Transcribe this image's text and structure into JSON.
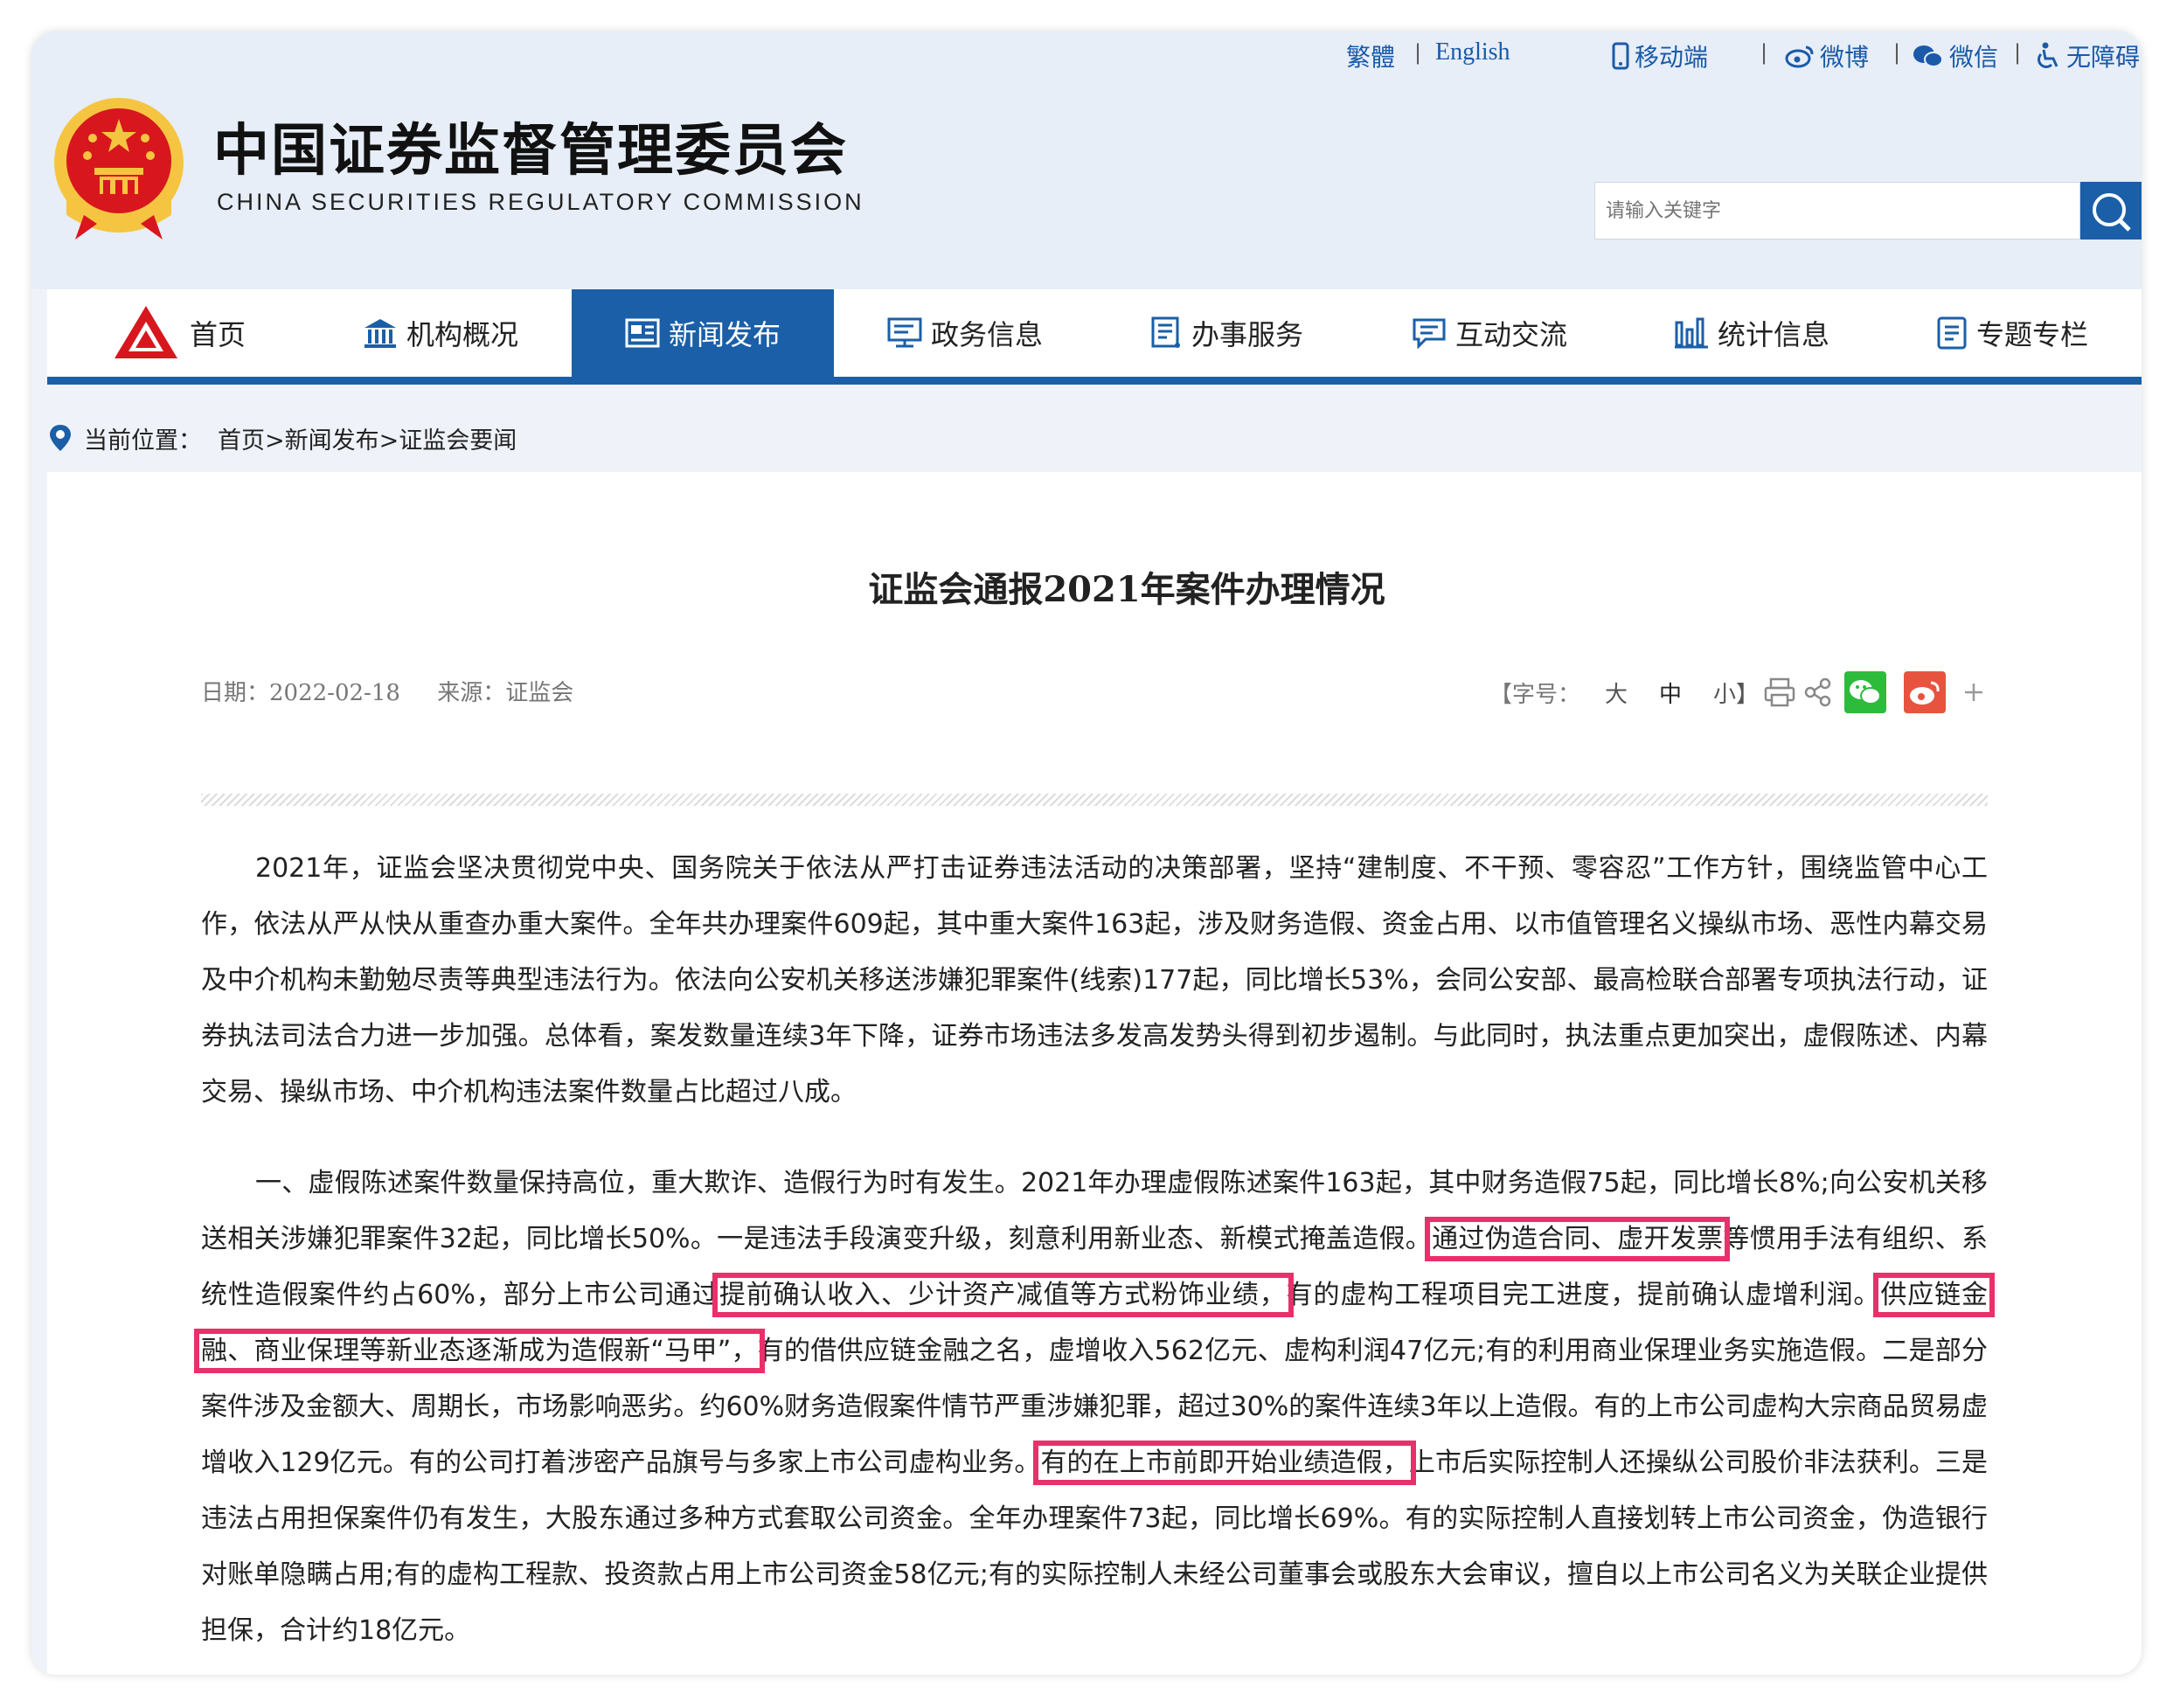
{
  "header": {
    "title_cn": "中国证券监督管理委员会",
    "title_en": "CHINA SECURITIES REGULATORY COMMISSION",
    "top_links": [
      "繁體",
      "English",
      "移动端",
      "微博",
      "微信",
      "无障碍"
    ],
    "search_placeholder": "请输入关键字"
  },
  "nav": {
    "items": [
      "首页",
      "机构概况",
      "新闻发布",
      "政务信息",
      "办事服务",
      "互动交流",
      "统计信息",
      "专题专栏"
    ],
    "active": "新闻发布"
  },
  "breadcrumb": {
    "label": "当前位置：",
    "path": "首页>新闻发布>证监会要闻"
  },
  "article": {
    "title": "证监会通报2021年案件办理情况",
    "date": "日期：2022-02-18",
    "source": "来源：证监会",
    "font_size_label": "【字号：",
    "font_sizes": [
      "大",
      "中",
      "小】"
    ],
    "p1": "2021年，证监会坚决贯彻党中央、国务院关于依法从严打击证券违法活动的决策部署，坚持“建制度、不干预、零容忍”工作方针，围绕监管中心工作，依法从严从快从重查办重大案件。全年共办理案件609起，其中重大案件163起，涉及财务造假、资金占用、以市值管理名义操纵市场、恶性内幕交易及中介机构未勤勉尽责等典型违法行为。依法向公安机关移送涉嫌犯罪案件(线索)177起，同比增长53%，会同公安部、最高检联合部署专项执法行动，证券执法司法合力进一步加强。总体看，案发数量连续3年下降，证券市场违法多发高发势头得到初步遏制。与此同时，执法重点更加突出，虚假陈述、内幕交易、操纵市场、中介机构违法案件数量占比超过八成。",
    "p2_a": "一、虚假陈述案件数量保持高位，重大欺诈、造假行为时有发生。2021年办理虚假陈述案件163起，其中财务造假75起，同比增长8%;向公安机关移送相关涉嫌犯罪案件32起，同比增长50%。一是违法手段演变升级，刻意利用新业态、新模式掩盖造假。",
    "p2_h1": "通过伪造合同、虚开发票",
    "p2_b": "等惯用手法有组织、系统性造假案件约占60%，部分上市公司通过",
    "p2_h2": "提前确认收入、少计资产减值等方式粉饰业绩，",
    "p2_c": "有的虚构工程项目完工进度，提前确认虚增利润。",
    "p2_h3": "供应链金融、商业保理等新业态逐渐成为造假新“马甲”，",
    "p2_d": "有的借供应链金融之名，虚增收入562亿元、虚构利润47亿元;有的利用商业保理业务实施造假。二是部分案件涉及金额大、周期长，市场影响恶劣。约60%财务造假案件情节严重涉嫌犯罪，超过30%的案件连续3年以上造假。有的上市公司虚构大宗商品贸易虚增收入129亿元。有的公司打着涉密产品旗号与多家上市公司虚构业务。",
    "p2_h4": "有的在上市前即开始业绩造假，",
    "p2_e": "上市后实际控制人还操纵公司股价非法获利。三是违法占用担保案件仍有发生，大股东通过多种方式套取公司资金。全年办理案件73起，同比增长69%。有的实际控制人直接划转上市公司资金，伪造银行对账单隐瞒占用;有的虚构工程款、投资款占用上市公司资金58亿元;有的实际控制人未经公司董事会或股东大会审议，擅自以上市公司名义为关联企业提供担保，合计约18亿元。"
  },
  "colors": {
    "brand_blue": "#1a5fa8",
    "highlight": "#e8306a",
    "emblem_red": "#d7171d",
    "emblem_gold": "#f5c542"
  },
  "icons": [
    "national-emblem-icon",
    "search-icon",
    "mobile-icon",
    "weibo-icon",
    "wechat-icon",
    "accessibility-icon",
    "home-logo-icon",
    "building-icon",
    "newspaper-icon",
    "monitor-icon",
    "list-icon",
    "chat-icon",
    "chart-icon",
    "document-icon",
    "location-pin-icon",
    "print-icon",
    "share-icon",
    "plus-icon"
  ]
}
